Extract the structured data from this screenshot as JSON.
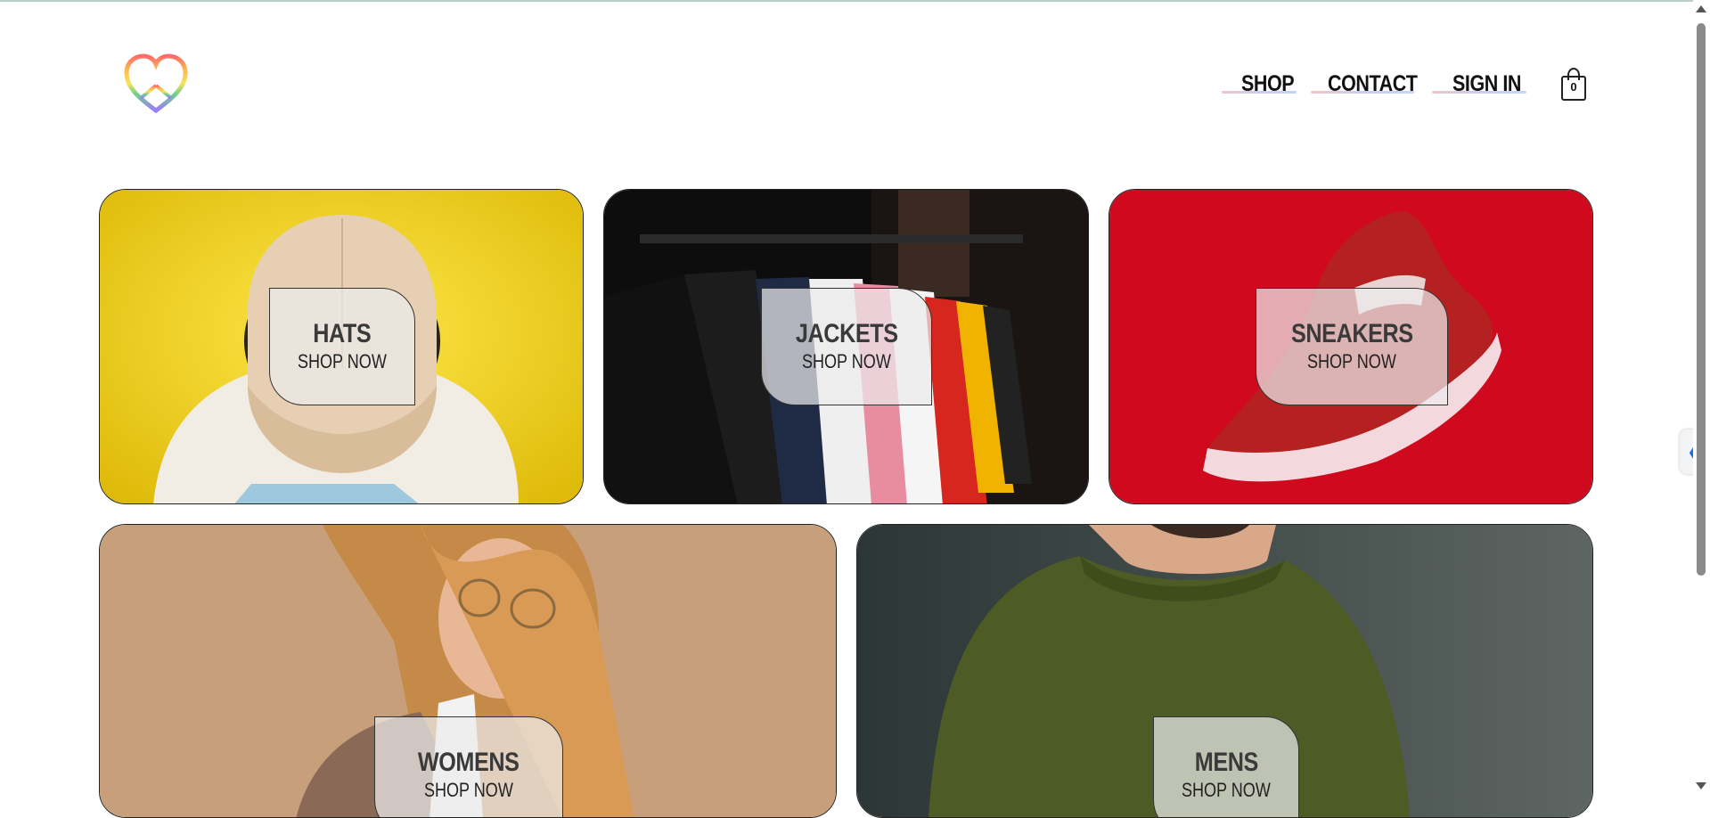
{
  "nav": {
    "links": [
      "SHOP",
      "CONTACT",
      "SIGN IN"
    ],
    "cart_count": "0"
  },
  "categories": [
    {
      "title": "HATS",
      "cta": "SHOP NOW"
    },
    {
      "title": "JACKETS",
      "cta": "SHOP NOW"
    },
    {
      "title": "SNEAKERS",
      "cta": "SHOP NOW"
    },
    {
      "title": "WOMENS",
      "cta": "SHOP NOW"
    },
    {
      "title": "MENS",
      "cta": "SHOP NOW"
    }
  ],
  "icons": {
    "logo": "peace-heart-icon",
    "cart": "shopping-bag-icon",
    "side_tab": "chevron-left-icon"
  },
  "side_tab_glyph": "❮"
}
